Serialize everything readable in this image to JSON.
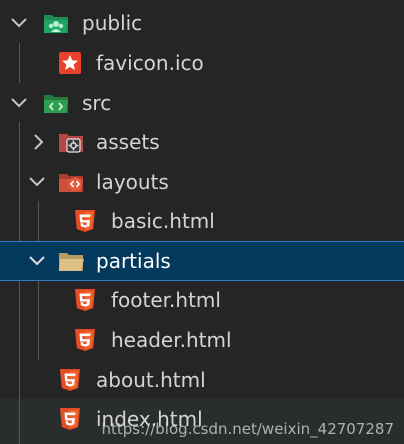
{
  "explorer": {
    "items": [
      {
        "label": "public",
        "kind": "folder",
        "icon": "folder-public-open-icon",
        "expanded": true
      },
      {
        "label": "favicon.ico",
        "kind": "file",
        "icon": "favicon-star-icon"
      },
      {
        "label": "src",
        "kind": "folder",
        "icon": "folder-src-open-icon",
        "expanded": true
      },
      {
        "label": "assets",
        "kind": "folder",
        "icon": "folder-assets-icon",
        "expanded": false
      },
      {
        "label": "layouts",
        "kind": "folder",
        "icon": "folder-layout-open-icon",
        "expanded": true
      },
      {
        "label": "basic.html",
        "kind": "file",
        "icon": "html5-icon"
      },
      {
        "label": "partials",
        "kind": "folder",
        "icon": "folder-open-icon",
        "expanded": true,
        "selected": true
      },
      {
        "label": "footer.html",
        "kind": "file",
        "icon": "html5-icon"
      },
      {
        "label": "header.html",
        "kind": "file",
        "icon": "html5-icon"
      },
      {
        "label": "about.html",
        "kind": "file",
        "icon": "html5-icon"
      },
      {
        "label": "index.html",
        "kind": "file",
        "icon": "html5-icon"
      }
    ]
  },
  "watermark": "https://blog.csdn.net/weixin_42707287",
  "colors": {
    "background": "#252526",
    "selected_background": "#04395e",
    "selected_border": "#2b79d0",
    "text": "#d4d4d4",
    "html5": "#e44d26",
    "favicon": "#e8412c",
    "public_folder": "#21a366",
    "src_folder": "#2e9e4f",
    "assets_folder": "#b54747",
    "layouts_folder": "#d1503b",
    "plain_folder": "#d6b77a"
  }
}
